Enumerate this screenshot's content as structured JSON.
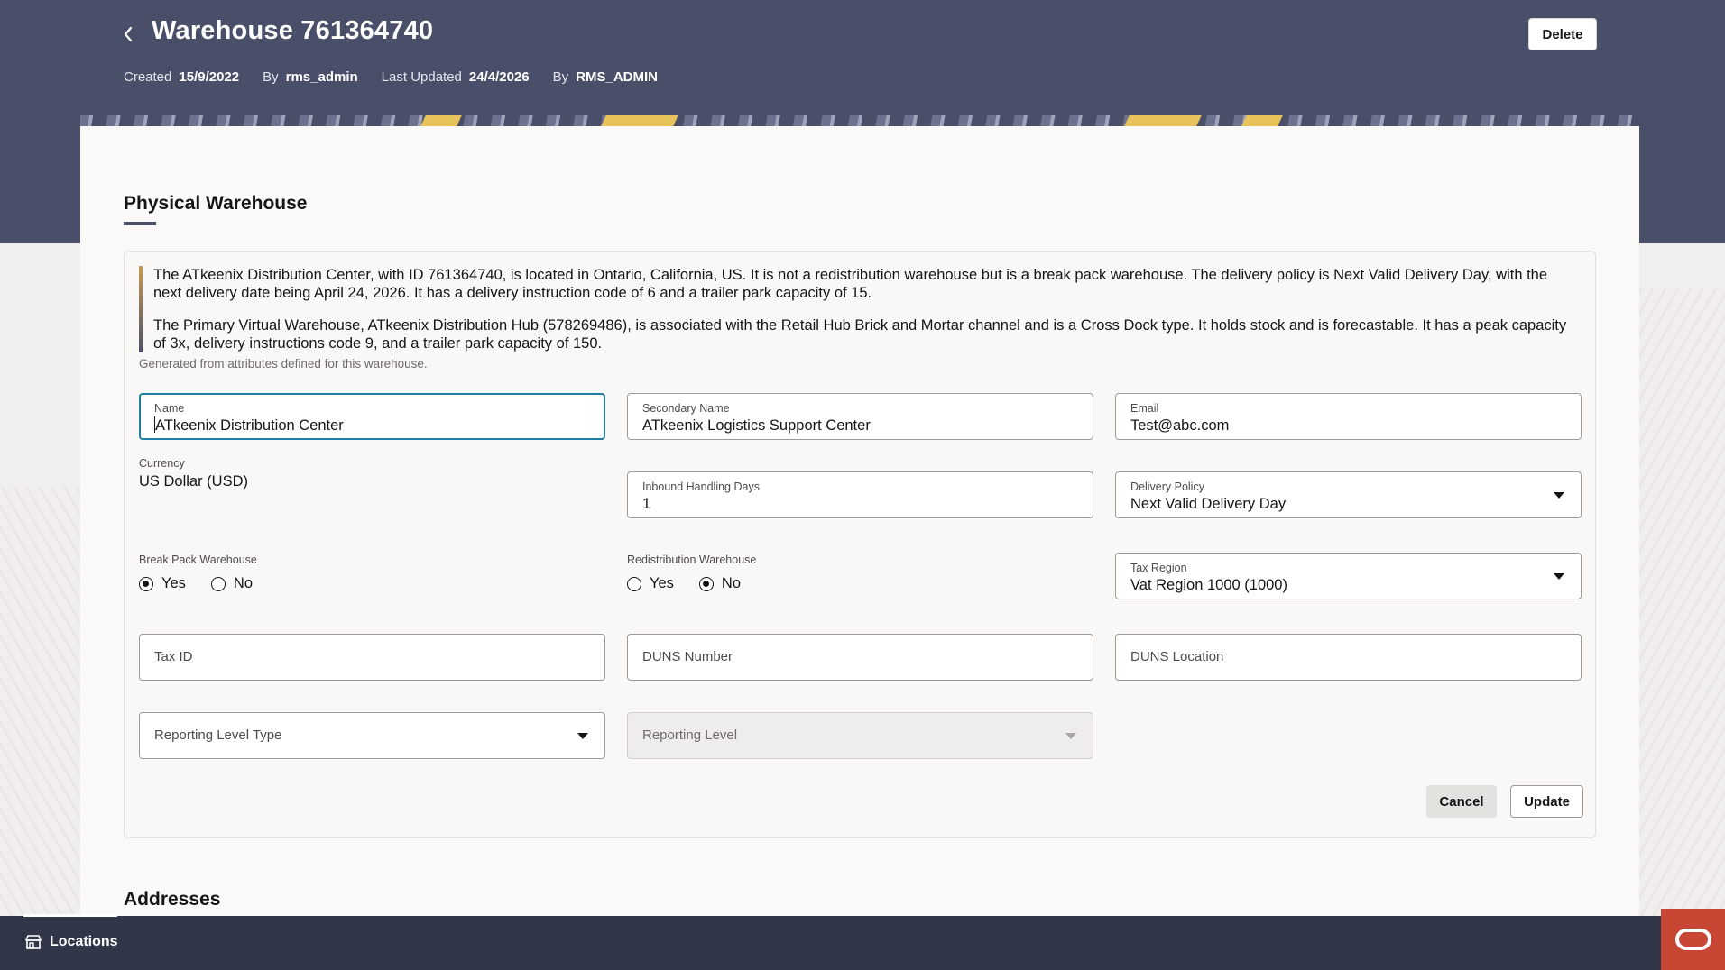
{
  "header": {
    "title": "Warehouse 761364740",
    "created_label": "Created",
    "created_value": "15/9/2022",
    "created_by_label": "By",
    "created_by_value": "rms_admin",
    "updated_label": "Last Updated",
    "updated_value": "24/4/2026",
    "updated_by_label": "By",
    "updated_by_value": "RMS_ADMIN",
    "delete_label": "Delete"
  },
  "section": {
    "title": "Physical Warehouse",
    "summary": [
      "The ATkeenix Distribution Center, with ID 761364740, is located in Ontario, California, US. It is not a redistribution warehouse but is a break pack warehouse. The delivery policy is Next Valid Delivery Day, with the next delivery date being April 24, 2026. It has a delivery instruction code of 6 and a trailer park capacity of 15.",
      "The Primary Virtual Warehouse, ATkeenix Distribution Hub (578269486), is associated with the Retail Hub Brick and Mortar channel and is a Cross Dock type. It holds stock and is forecastable. It has a peak capacity of 3x, delivery instructions code 9, and a trailer park capacity of 150."
    ],
    "summary_note": "Generated from attributes defined for this warehouse."
  },
  "form": {
    "name": {
      "label": "Name",
      "value": "ATkeenix Distribution Center"
    },
    "secondary_name": {
      "label": "Secondary Name",
      "value": "ATkeenix Logistics Support Center"
    },
    "email": {
      "label": "Email",
      "value": "Test@abc.com"
    },
    "currency": {
      "label": "Currency",
      "value": "US Dollar (USD)"
    },
    "inbound_handling_days": {
      "label": "Inbound Handling Days",
      "value": "1"
    },
    "delivery_policy": {
      "label": "Delivery Policy",
      "value": "Next Valid Delivery Day"
    },
    "break_pack": {
      "label": "Break Pack Warehouse",
      "yes": "Yes",
      "no": "No",
      "selected": "Yes"
    },
    "redistribution": {
      "label": "Redistribution Warehouse",
      "yes": "Yes",
      "no": "No",
      "selected": "No"
    },
    "tax_region": {
      "label": "Tax Region",
      "value": "Vat Region 1000 (1000)"
    },
    "tax_id": {
      "placeholder": "Tax ID"
    },
    "duns_number": {
      "placeholder": "DUNS Number"
    },
    "duns_location": {
      "placeholder": "DUNS Location"
    },
    "reporting_level_type": {
      "placeholder": "Reporting Level Type"
    },
    "reporting_level": {
      "placeholder": "Reporting Level"
    },
    "cancel_label": "Cancel",
    "update_label": "Update"
  },
  "addresses": {
    "title": "Addresses"
  },
  "footer": {
    "locations_label": "Locations"
  },
  "colors": {
    "header_bg": "#4a4f69",
    "footer_bg": "#313649",
    "focus_border": "#227e9e",
    "oracle_red": "#c74634"
  }
}
